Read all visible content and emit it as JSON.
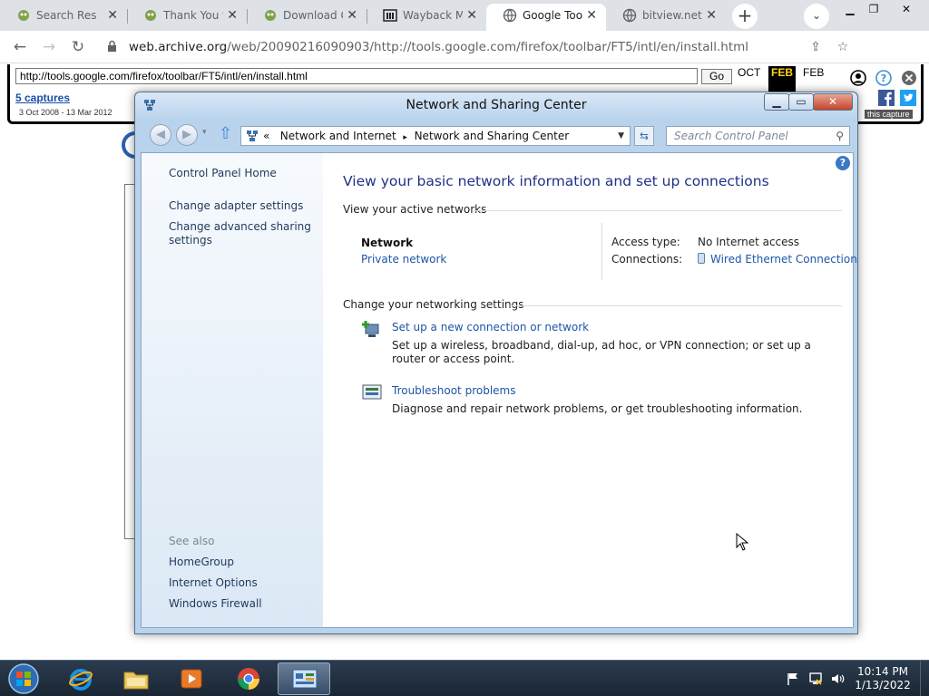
{
  "browser": {
    "tabs": [
      {
        "title": "Search Resul",
        "active": false
      },
      {
        "title": "Thank You fo",
        "active": false
      },
      {
        "title": "Download G",
        "active": false
      },
      {
        "title": "Wayback Ma",
        "active": false
      },
      {
        "title": "Google Tool",
        "active": true
      },
      {
        "title": "bitview.net",
        "active": false
      }
    ],
    "new_tab_glyph": "+",
    "url_host": "web.archive.org",
    "url_path": "/web/20090216090903/http://tools.google.com/firefox/toolbar/FT5/intl/en/install.html"
  },
  "wayback": {
    "url_value": "http://tools.google.com/firefox/toolbar/FT5/intl/en/install.html",
    "go_label": "Go",
    "captures_label": "5 captures",
    "date_range": "3 Oct 2008 - 13 Mar 2012",
    "months": {
      "prev": "OCT",
      "current": "FEB",
      "next": "FEB"
    },
    "about_label": "this capture"
  },
  "window": {
    "title": "Network and Sharing Center",
    "breadcrumb": {
      "prefix": "«",
      "items": [
        "Network and Internet",
        "Network and Sharing Center"
      ],
      "separator": "▸"
    },
    "search_placeholder": "Search Control Panel",
    "left_pane": {
      "home": "Control Panel Home",
      "links": [
        "Change adapter settings",
        "Change advanced sharing settings"
      ],
      "see_also_label": "See also",
      "see_also": [
        "HomeGroup",
        "Internet Options",
        "Windows Firewall"
      ]
    },
    "main": {
      "heading": "View your basic network information and set up connections",
      "active_networks_label": "View your active networks",
      "network_name": "Network",
      "network_type": "Private network",
      "access_type_label": "Access type:",
      "access_type_value": "No Internet access",
      "connections_label": "Connections:",
      "connections_value": "Wired Ethernet Connection",
      "change_settings_label": "Change your networking settings",
      "tasks": [
        {
          "title": "Set up a new connection or network",
          "desc": "Set up a wireless, broadband, dial-up, ad hoc, or VPN connection; or set up a router or access point."
        },
        {
          "title": "Troubleshoot problems",
          "desc": "Diagnose and repair network problems, or get troubleshooting information."
        }
      ]
    }
  },
  "taskbar": {
    "time": "10:14 PM",
    "date": "1/13/2022"
  },
  "colors": {
    "heading": "#1e3287",
    "link": "#1c56a8",
    "taskbar": "#1a2633"
  }
}
